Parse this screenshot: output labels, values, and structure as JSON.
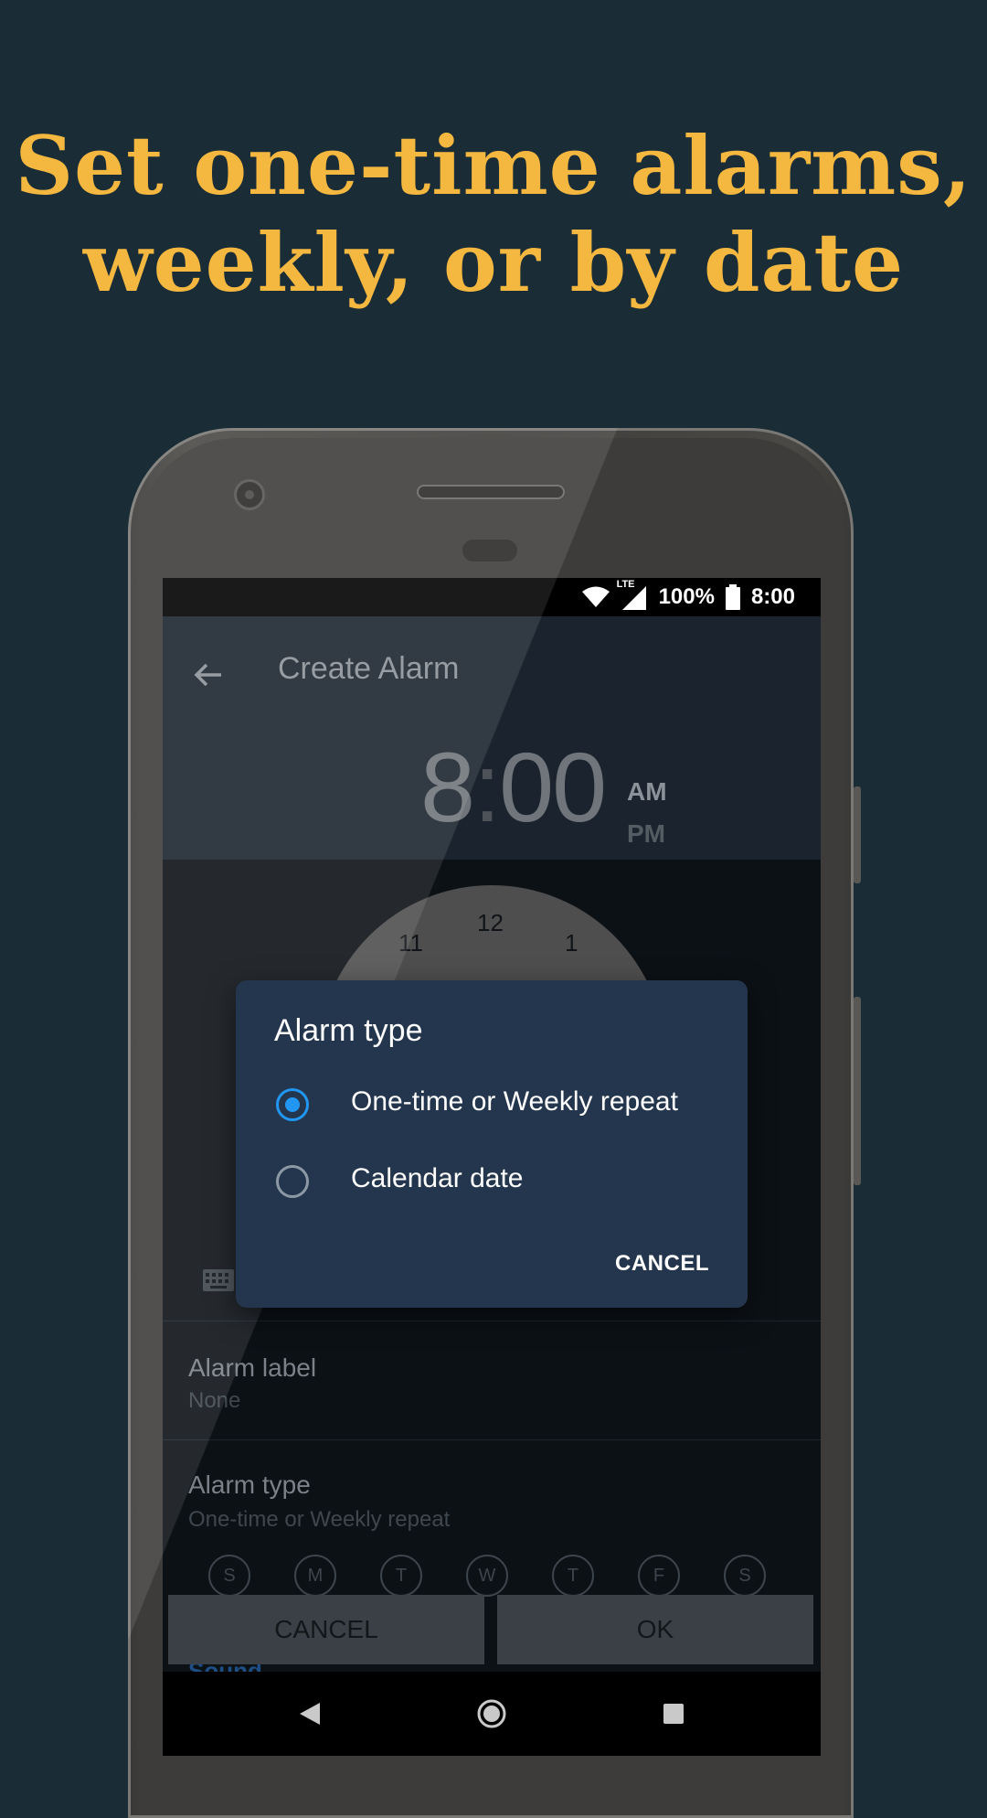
{
  "headline": {
    "line1": "Set one-time alarms,",
    "line2": "weekly, or by date"
  },
  "colors": {
    "background": "#1a2d37",
    "headline": "#f4b740",
    "dialog": "#24364d",
    "radio_on": "#2196f3"
  },
  "status_bar": {
    "network": "LTE",
    "battery": "100%",
    "time": "8:00",
    "icons": [
      "wifi-icon",
      "signal-icon",
      "battery-icon"
    ]
  },
  "app_bar": {
    "back_icon": "arrow-left-icon",
    "title": "Create Alarm"
  },
  "time": {
    "hour": "8",
    "separator": ":",
    "minutes": "00",
    "am": "AM",
    "pm": "PM"
  },
  "dial": {
    "numbers": [
      "11",
      "12",
      "1"
    ]
  },
  "settings": {
    "label_title": "Alarm label",
    "label_value": "None",
    "type_title": "Alarm type",
    "type_value": "One-time or Weekly repeat",
    "days": [
      "S",
      "M",
      "T",
      "W",
      "T",
      "F",
      "S"
    ],
    "sound_peek": "Sound"
  },
  "bottom_buttons": {
    "cancel": "CANCEL",
    "ok": "OK"
  },
  "dialog": {
    "title": "Alarm type",
    "options": [
      {
        "label": "One-time or Weekly repeat",
        "selected": true
      },
      {
        "label": "Calendar date",
        "selected": false
      }
    ],
    "cancel": "CANCEL"
  },
  "nav_bar": {
    "icons": [
      "back-triangle-icon",
      "home-circle-icon",
      "recents-square-icon"
    ]
  }
}
